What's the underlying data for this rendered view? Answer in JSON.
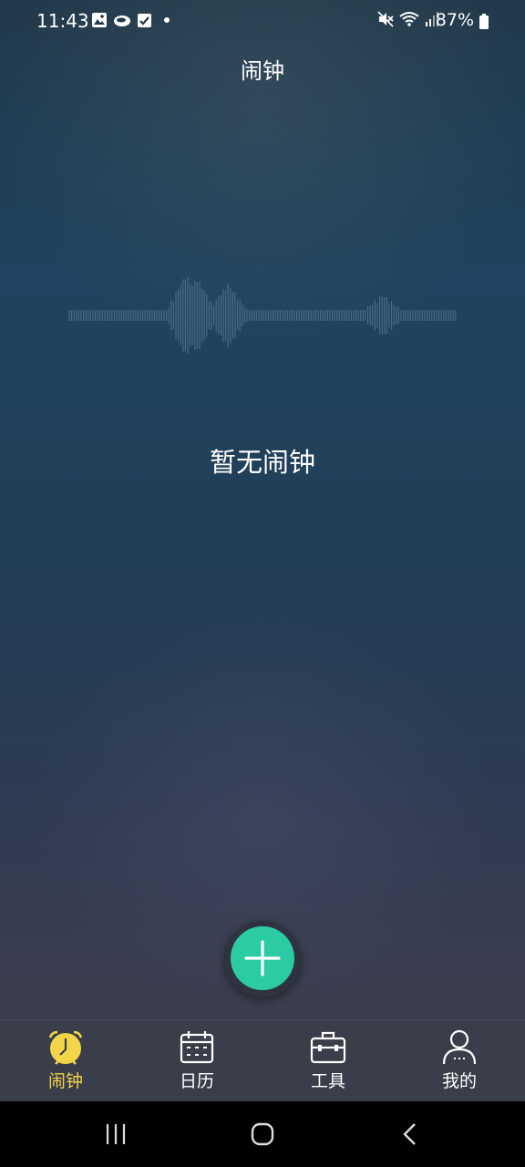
{
  "status_bar": {
    "time": "11:43",
    "battery": "87%",
    "left_icons": [
      "gallery-icon",
      "cloud-icon",
      "checkbox-icon",
      "dot-icon"
    ],
    "right_icons": [
      "mute-icon",
      "wifi-icon",
      "signal-icon",
      "battery-icon"
    ]
  },
  "header": {
    "title": "闹钟"
  },
  "main": {
    "empty_message": "暂无闹钟"
  },
  "fab": {
    "icon": "plus-icon",
    "color": "#2bcba3"
  },
  "bottom_nav": {
    "items": [
      {
        "label": "闹钟",
        "icon": "alarm-clock-icon",
        "active": true
      },
      {
        "label": "日历",
        "icon": "calendar-icon",
        "active": false
      },
      {
        "label": "工具",
        "icon": "toolbox-icon",
        "active": false
      },
      {
        "label": "我的",
        "icon": "user-icon",
        "active": false
      }
    ],
    "active_color": "#f3d54a"
  },
  "system_nav": {
    "buttons": [
      "recents-icon",
      "home-icon",
      "back-icon"
    ]
  }
}
